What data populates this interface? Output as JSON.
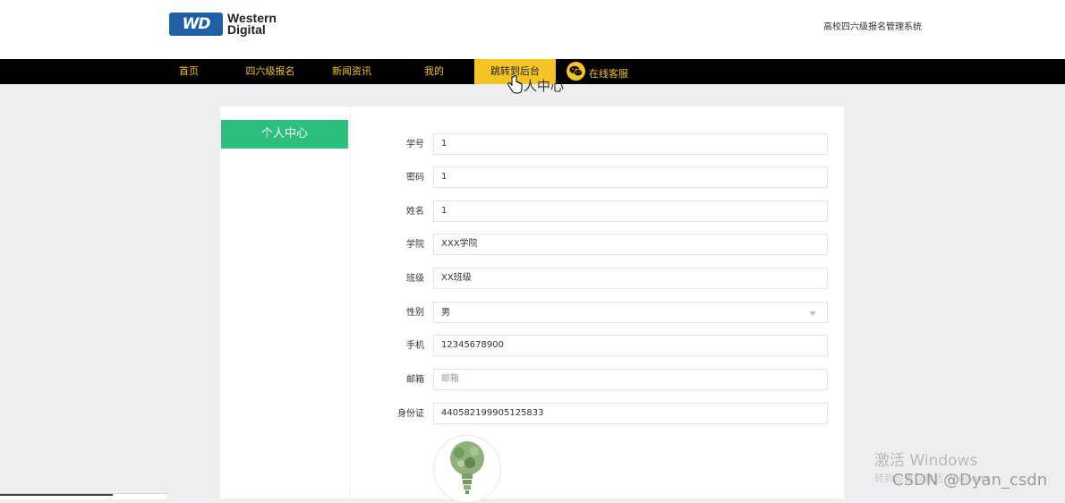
{
  "header": {
    "logo_badge": "WD",
    "logo_line1": "Western",
    "logo_line2": "Digital",
    "site_title": "高校四六级报名管理系统"
  },
  "nav": {
    "items": [
      {
        "label": "首页"
      },
      {
        "label": "四六级报名"
      },
      {
        "label": "新闻资讯"
      },
      {
        "label": "我的"
      },
      {
        "label": "跳转到后台"
      }
    ],
    "service_label": "在线客服"
  },
  "page_heading": "人中心",
  "sidebar": {
    "items": [
      {
        "label": "个人中心"
      }
    ]
  },
  "form": {
    "student_no": {
      "label": "学号",
      "value": "1"
    },
    "password": {
      "label": "密码",
      "value": "1"
    },
    "name": {
      "label": "姓名",
      "value": "1"
    },
    "college": {
      "label": "学院",
      "value": "XXX学院"
    },
    "class": {
      "label": "班级",
      "value": "XX班级"
    },
    "gender": {
      "label": "性别",
      "value": "男"
    },
    "phone": {
      "label": "手机",
      "value": "12345678900"
    },
    "email": {
      "label": "邮箱",
      "value": "",
      "placeholder": "邮箱"
    },
    "id_card": {
      "label": "身份证",
      "value": "440582199905125833"
    }
  },
  "watermark": {
    "activate": "激活 Windows",
    "activate_sub": "转到设置以激活 Windows",
    "csdn": "CSDN @Dyan_csdn"
  },
  "colors": {
    "accent_yellow": "#f3c424",
    "sidebar_green": "#2dbf7d",
    "logo_blue": "#1f5fa6"
  }
}
